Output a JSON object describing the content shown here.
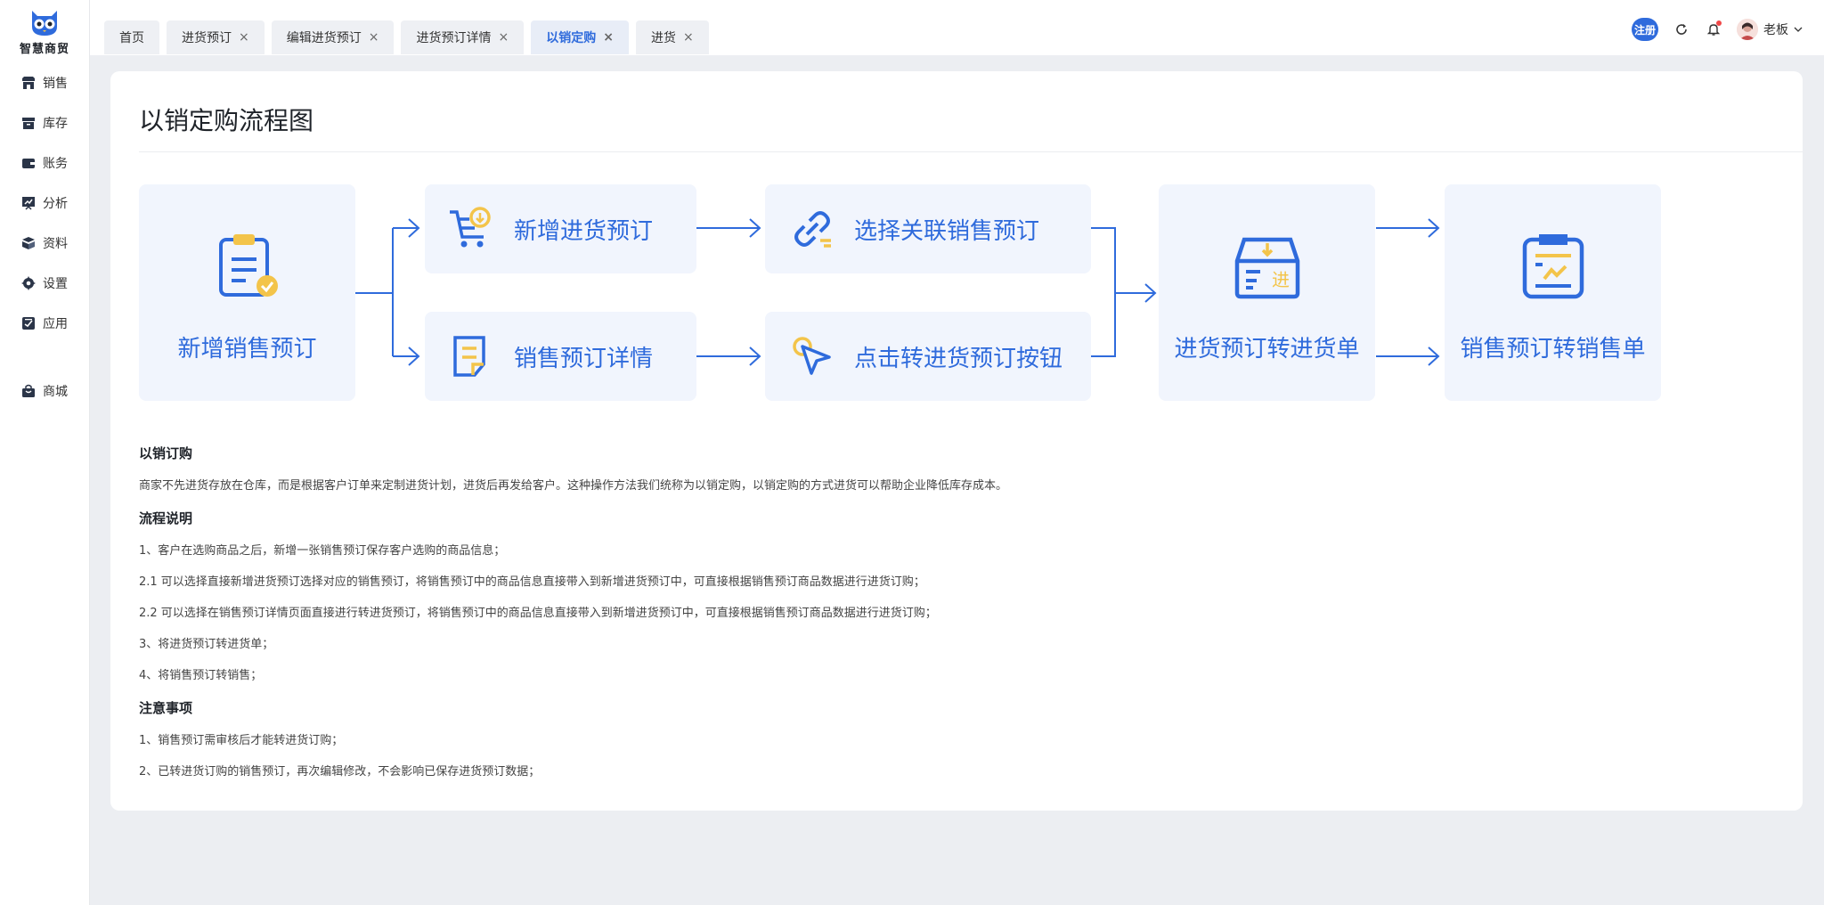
{
  "app": {
    "name": "智慧商贸"
  },
  "sidebar": {
    "items": [
      {
        "label": "销售",
        "icon": "store-icon"
      },
      {
        "label": "库存",
        "icon": "inventory-icon"
      },
      {
        "label": "账务",
        "icon": "wallet-icon"
      },
      {
        "label": "分析",
        "icon": "analysis-icon"
      },
      {
        "label": "资料",
        "icon": "data-icon"
      },
      {
        "label": "设置",
        "icon": "gear-icon"
      },
      {
        "label": "应用",
        "icon": "apps-icon"
      },
      {
        "label": "商城",
        "icon": "shopping-bag-icon"
      }
    ]
  },
  "tabs": [
    {
      "label": "首页"
    },
    {
      "label": "进货预订"
    },
    {
      "label": "编辑进货预订"
    },
    {
      "label": "进货预订详情"
    },
    {
      "label": "以销定购"
    },
    {
      "label": "进货"
    }
  ],
  "header": {
    "register_badge": "注册",
    "user_name": "老板",
    "brand_color": "#2f6bdc"
  },
  "page": {
    "title": "以销定购流程图"
  },
  "flow": {
    "new_sales_order": "新增销售预订",
    "new_purchase_order": "新增进货预订",
    "select_linked_sales": "选择关联销售预订",
    "sales_order_detail": "销售预订详情",
    "click_convert_button": "点击转进货预订按钮",
    "purchase_to_receipt": "进货预订转进货单",
    "sales_to_sale_slip": "销售预订转销售单",
    "badge_jin": "进"
  },
  "content": {
    "section1_title": "以销订购",
    "section1_text": "商家不先进货存放在仓库，而是根据客户订单来定制进货计划，进货后再发给客户。这种操作方法我们统称为以销定购，以销定购的方式进货可以帮助企业降低库存成本。",
    "section2_title": "流程说明",
    "steps": [
      "1、客户在选购商品之后，新增一张销售预订保存客户选购的商品信息；",
      "2.1 可以选择直接新增进货预订选择对应的销售预订，将销售预订中的商品信息直接带入到新增进货预订中，可直接根据销售预订商品数据进行进货订购；",
      "2.2 可以选择在销售预订详情页面直接进行转进货预订，将销售预订中的商品信息直接带入到新增进货预订中，可直接根据销售预订商品数据进行进货订购；",
      "3、将进货预订转进货单；",
      "4、将销售预订转销售；"
    ],
    "section3_title": "注意事项",
    "notes": [
      "1、销售预订需审核后才能转进货订购；",
      "2、已转进货订购的销售预订，再次编辑修改，不会影响已保存进货预订数据；"
    ]
  }
}
